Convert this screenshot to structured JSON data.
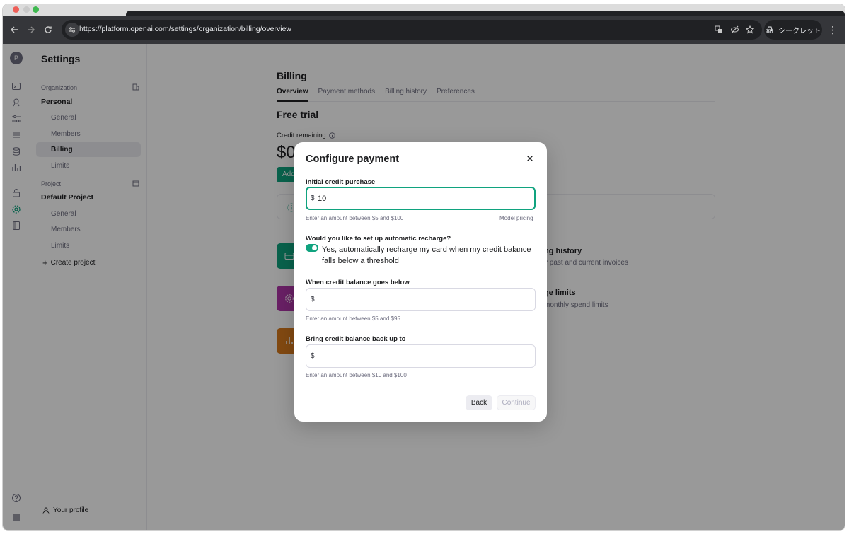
{
  "browser": {
    "url": "https://platform.openai.com/settings/organization/billing/overview",
    "incognito_label": "シークレット"
  },
  "rail": {
    "avatar_letter": "P"
  },
  "sidebar": {
    "title": "Settings",
    "organization_section": "Organization",
    "organization_name": "Personal",
    "organization_items": [
      {
        "label": "General"
      },
      {
        "label": "Members"
      },
      {
        "label": "Billing"
      },
      {
        "label": "Limits"
      }
    ],
    "project_section": "Project",
    "project_name": "Default Project",
    "project_items": [
      {
        "label": "General"
      },
      {
        "label": "Members"
      },
      {
        "label": "Limits"
      }
    ],
    "create_project": "Create project",
    "your_profile": "Your profile"
  },
  "billing": {
    "title": "Billing",
    "tabs": [
      {
        "label": "Overview"
      },
      {
        "label": "Payment methods"
      },
      {
        "label": "Billing history"
      },
      {
        "label": "Preferences"
      }
    ],
    "plan": "Free trial",
    "credit_label": "Credit remaining",
    "credit_value": "$0.0",
    "add_button": "Add",
    "cards": [
      {
        "title": "ng history",
        "desc": "v past and current invoices"
      },
      {
        "title": "ge limits",
        "desc": "monthly spend limits"
      }
    ]
  },
  "modal": {
    "title": "Configure payment",
    "initial_label": "Initial credit purchase",
    "currency": "$",
    "initial_value": "10",
    "initial_hint": "Enter an amount between $5 and $100",
    "model_pricing": "Model pricing",
    "recharge_question": "Would you like to set up automatic recharge?",
    "recharge_option": "Yes, automatically recharge my card when my credit balance falls below a threshold",
    "recharge_enabled": true,
    "below_label": "When credit balance goes below",
    "below_value": "",
    "below_hint": "Enter an amount between $5 and $95",
    "backup_label": "Bring credit balance back up to",
    "backup_value": "",
    "backup_hint": "Enter an amount between $10 and $100",
    "back_button": "Back",
    "continue_button": "Continue"
  },
  "colors": {
    "accent": "#10a37f",
    "purple": "#b036a8",
    "orange": "#d97a1d"
  }
}
